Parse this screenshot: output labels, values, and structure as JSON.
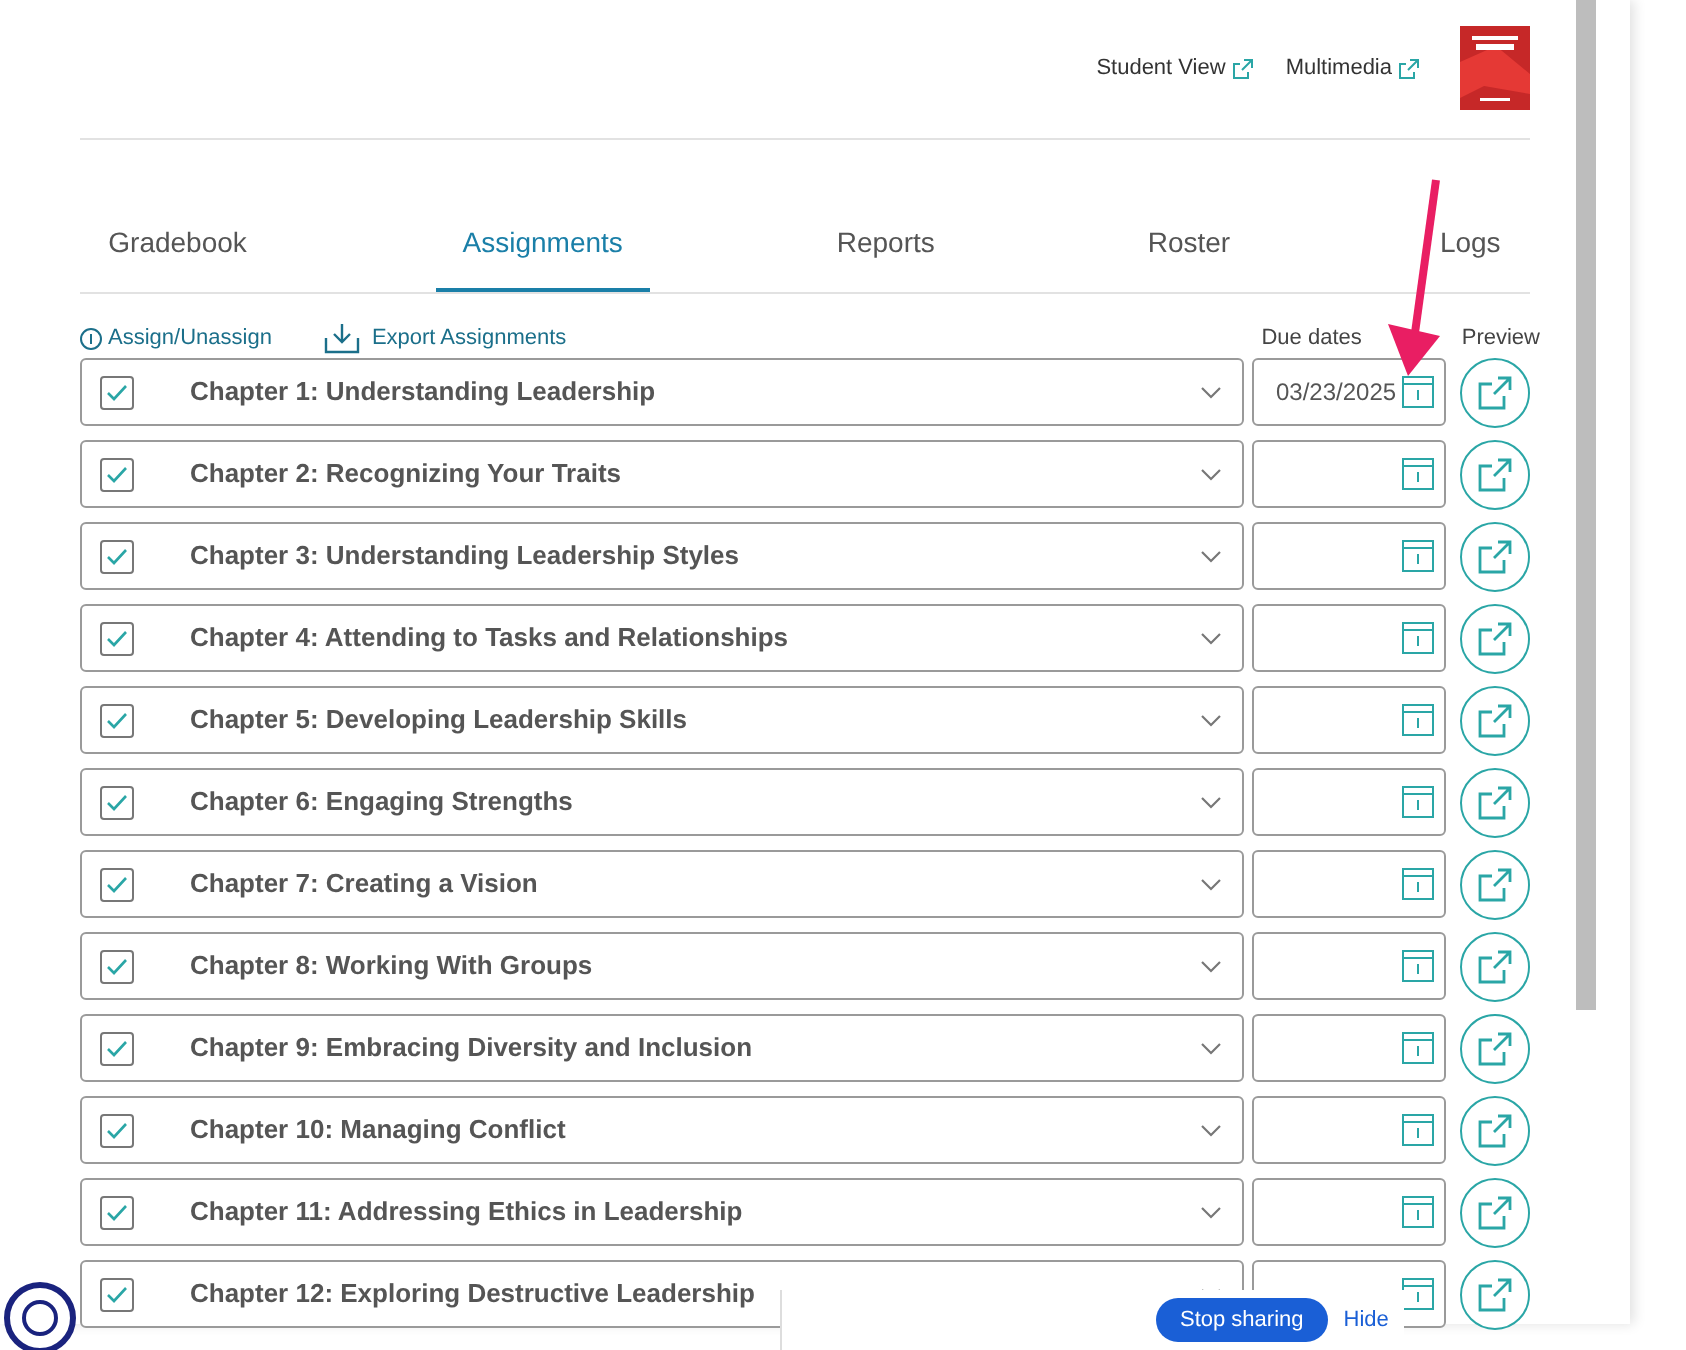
{
  "header": {
    "links": [
      {
        "label": "Student View"
      },
      {
        "label": "Multimedia"
      }
    ]
  },
  "tabs": [
    {
      "label": "Gradebook",
      "selected": false
    },
    {
      "label": "Assignments",
      "selected": true
    },
    {
      "label": "Reports",
      "selected": false
    },
    {
      "label": "Roster",
      "selected": false
    },
    {
      "label": "Logs",
      "selected": false
    }
  ],
  "toolbar": {
    "assign": "Assign/Unassign",
    "export": "Export Assignments",
    "due_dates_heading": "Due dates",
    "preview_heading": "Preview"
  },
  "assignments": [
    {
      "title": "Chapter 1: Understanding Leadership",
      "checked": true,
      "due_date": "03/23/2025"
    },
    {
      "title": "Chapter 2: Recognizing Your Traits",
      "checked": true
    },
    {
      "title": "Chapter 3: Understanding Leadership Styles",
      "checked": true
    },
    {
      "title": "Chapter 4: Attending to Tasks and Relationships",
      "checked": true
    },
    {
      "title": "Chapter 5: Developing Leadership Skills",
      "checked": true
    },
    {
      "title": "Chapter 6: Engaging Strengths",
      "checked": true
    },
    {
      "title": "Chapter 7: Creating a Vision",
      "checked": true
    },
    {
      "title": "Chapter 8: Working With Groups",
      "checked": true
    },
    {
      "title": "Chapter 9: Embracing Diversity and Inclusion",
      "checked": true
    },
    {
      "title": "Chapter 10: Managing Conflict",
      "checked": true
    },
    {
      "title": "Chapter 11: Addressing Ethics in Leadership",
      "checked": true
    },
    {
      "title": "Chapter 12: Exploring Destructive Leadership",
      "checked": true
    }
  ],
  "share_bar": {
    "stop_button": "Stop sharing",
    "hide_link": "Hide"
  }
}
